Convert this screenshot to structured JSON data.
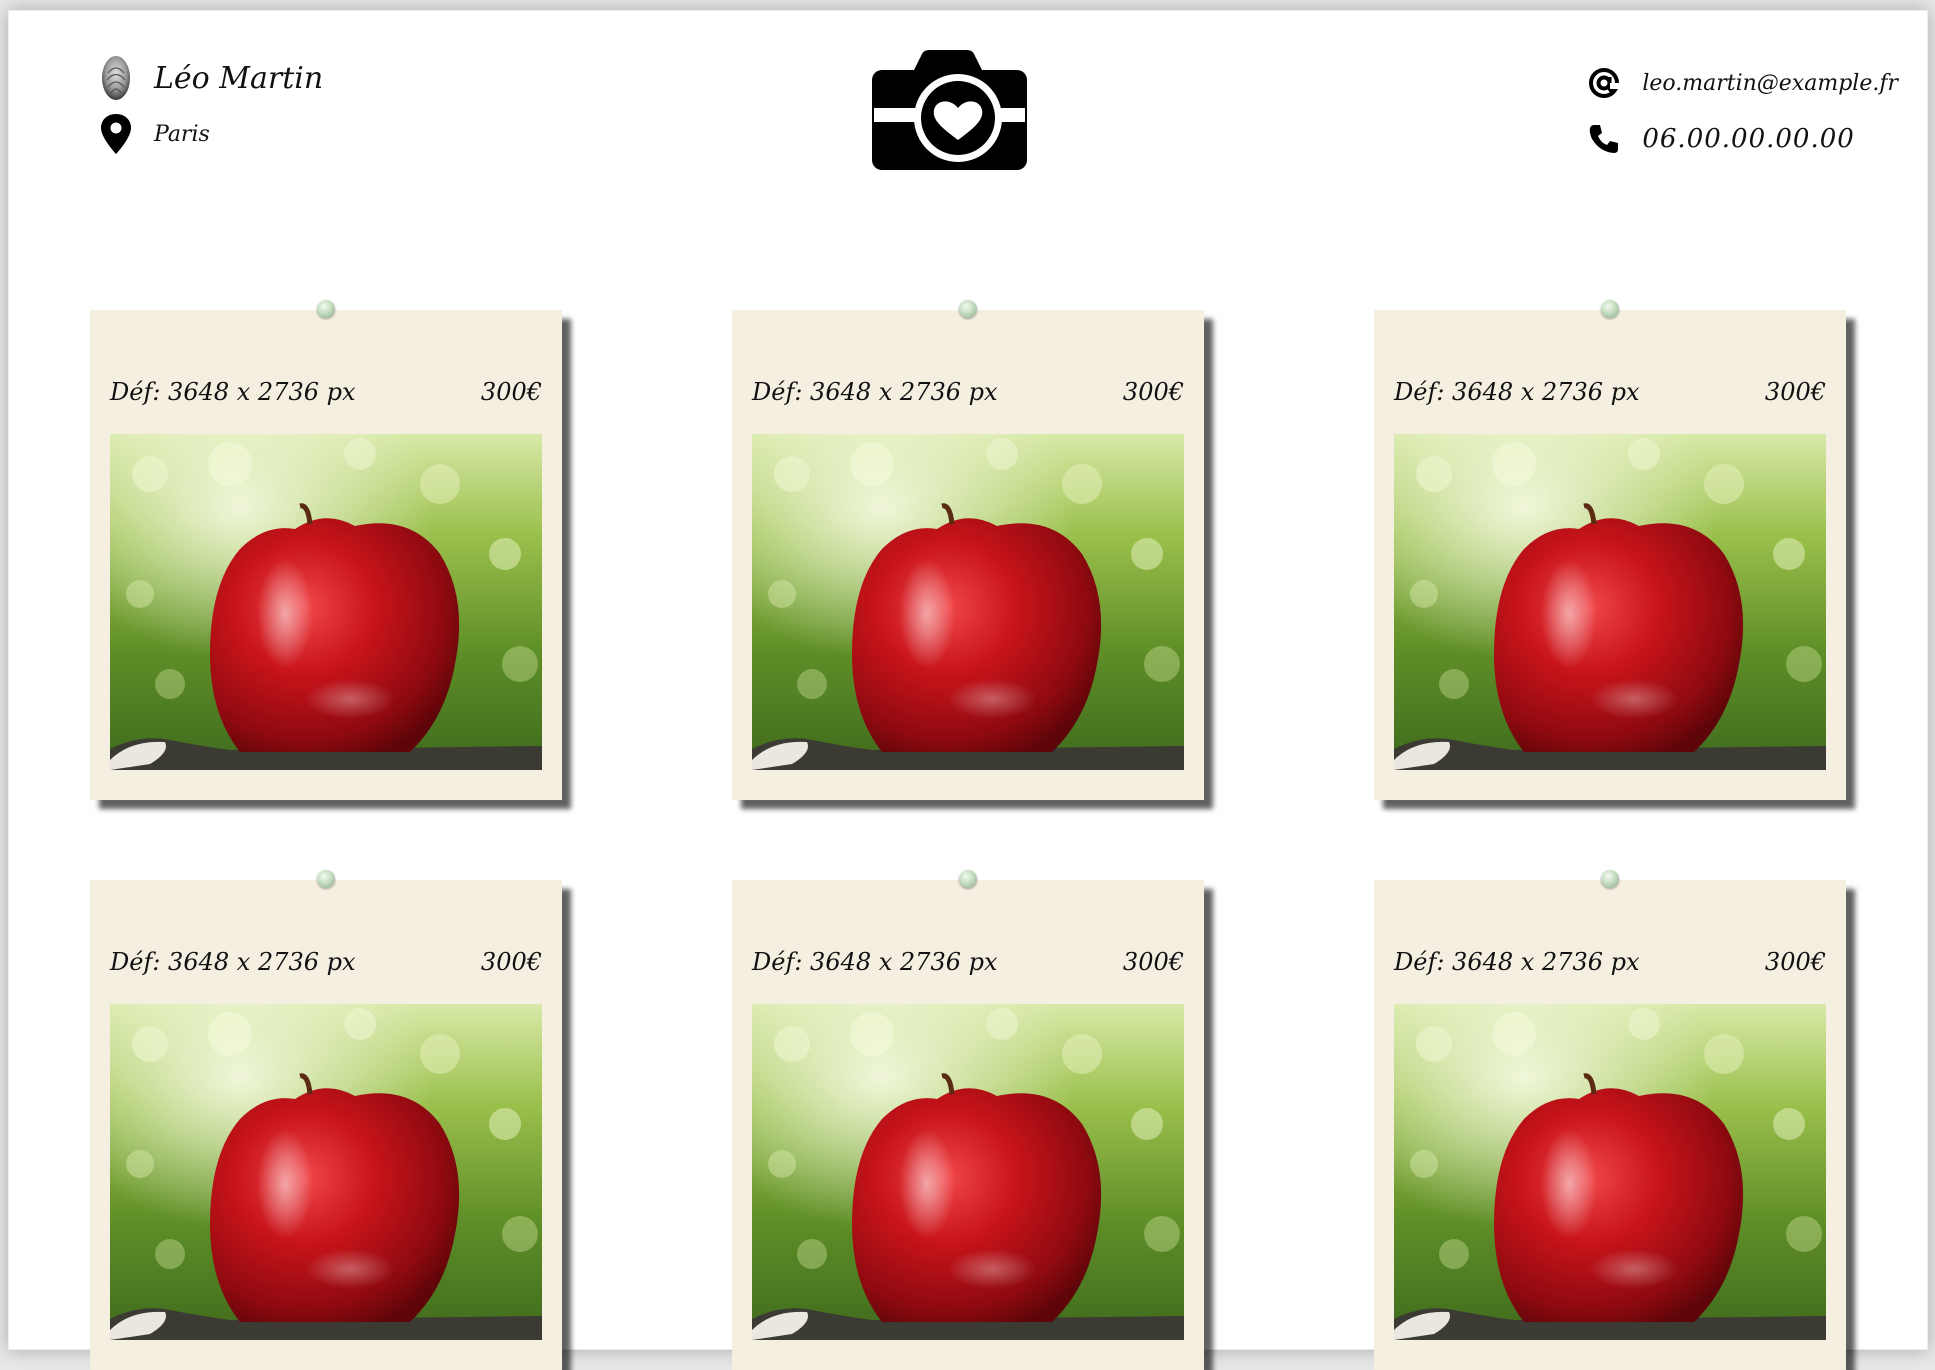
{
  "header": {
    "name": "Léo Martin",
    "city": "Paris",
    "email": "leo.martin@example.fr",
    "phone": "06.00.00.00.00",
    "icons": {
      "name": "fingerprint-icon",
      "city": "location-pin-icon",
      "email": "at-sign-icon",
      "phone": "phone-icon",
      "logo": "camera-heart-icon"
    }
  },
  "photos": [
    {
      "definition": "Déf: 3648 x 2736 px",
      "price": "300€"
    },
    {
      "definition": "Déf: 3648 x 2736 px",
      "price": "300€"
    },
    {
      "definition": "Déf: 3648 x 2736 px",
      "price": "300€"
    },
    {
      "definition": "Déf: 3648 x 2736 px",
      "price": "300€"
    },
    {
      "definition": "Déf: 3648 x 2736 px",
      "price": "300€"
    },
    {
      "definition": "Déf: 3648 x 2736 px",
      "price": "300€"
    }
  ],
  "colors": {
    "card_background": "#f5efe2",
    "page_background": "#ffffff",
    "pin": "#b9d4b4",
    "apple_red": "#c8141a",
    "foliage_green": "#6f9b2b"
  }
}
